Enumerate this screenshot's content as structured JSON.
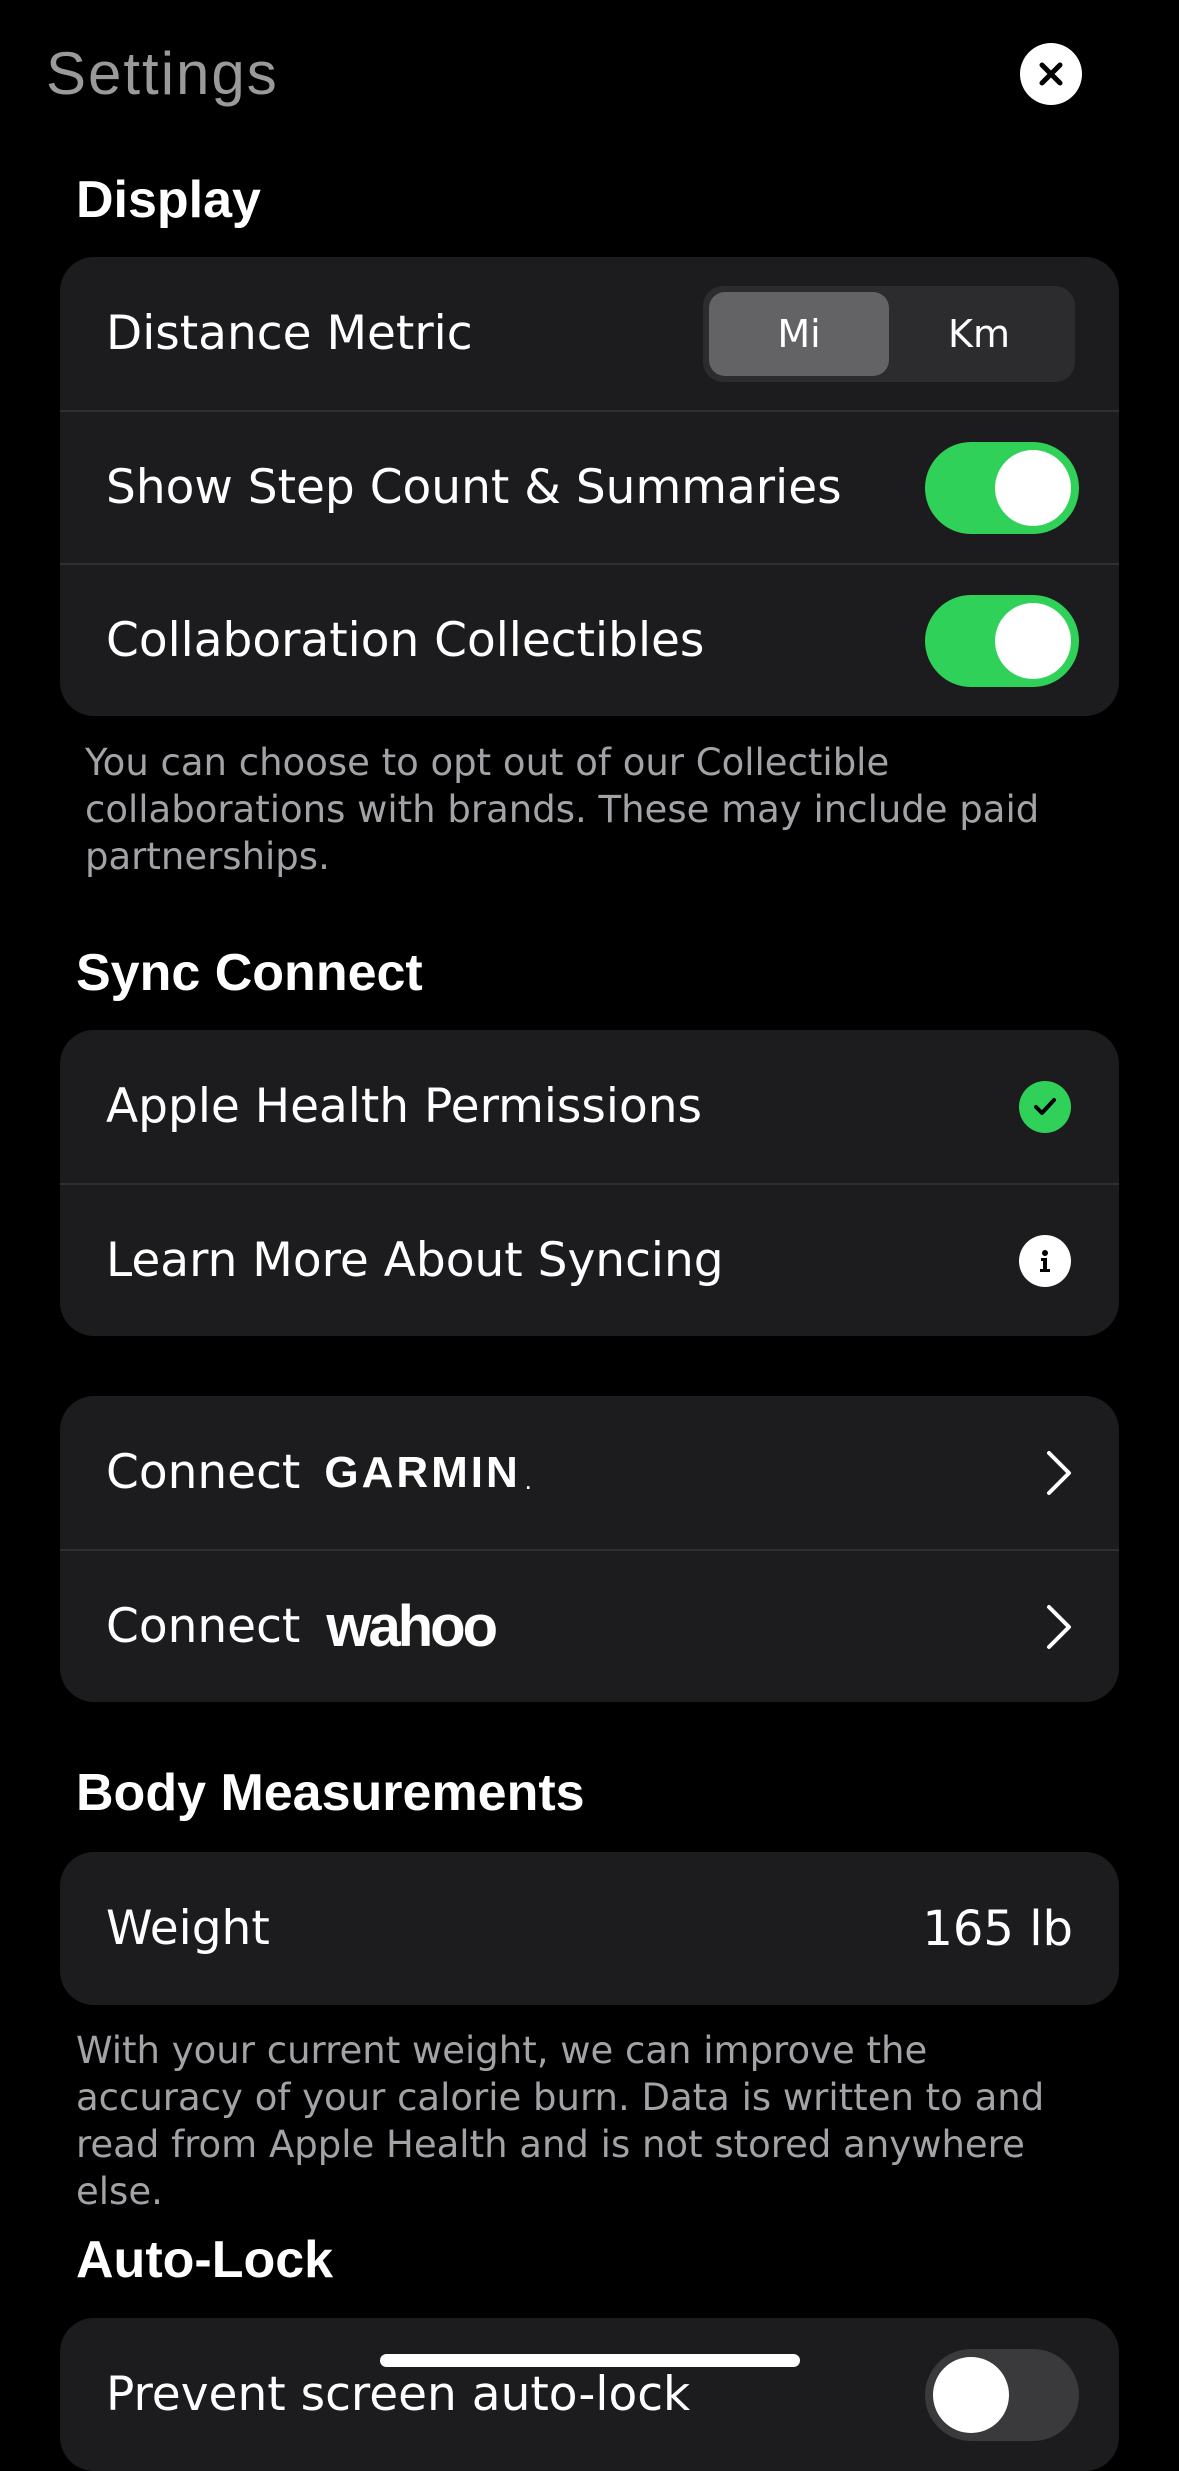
{
  "header": {
    "title": "Settings",
    "close_icon": "close-icon"
  },
  "display": {
    "title": "Display",
    "distance_metric": {
      "label": "Distance Metric",
      "options": [
        "Mi",
        "Km"
      ],
      "selected": "Mi"
    },
    "show_step_count": {
      "label": "Show Step Count & Summaries",
      "enabled": true
    },
    "collaboration_collectibles": {
      "label": "Collaboration Collectibles",
      "enabled": true
    },
    "footnote": "You can choose to opt out of our Collectible collaborations with brands. These may include paid partnerships."
  },
  "sync_connect": {
    "title": "Sync Connect",
    "apple_health": {
      "label": "Apple Health Permissions",
      "status_icon": "checkmark-circle-icon"
    },
    "learn_more": {
      "label": "Learn More About Syncing",
      "icon": "info-icon"
    },
    "garmin": {
      "label": "Connect",
      "brand": "GARMIN"
    },
    "wahoo": {
      "label": "Connect",
      "brand": "wahoo"
    }
  },
  "body_measurements": {
    "title": "Body Measurements",
    "weight": {
      "label": "Weight",
      "value": "165 lb"
    },
    "footnote": "With your current weight, we can improve the accuracy of your calorie burn. Data is written to and read from Apple Health and is not stored anywhere else."
  },
  "auto_lock": {
    "title": "Auto-Lock",
    "prevent": {
      "label": "Prevent screen auto-lock",
      "enabled": false
    }
  },
  "colors": {
    "background": "#000000",
    "card": "#1c1c1e",
    "accent_green": "#30d158",
    "secondary_text": "#a2a2a7"
  }
}
